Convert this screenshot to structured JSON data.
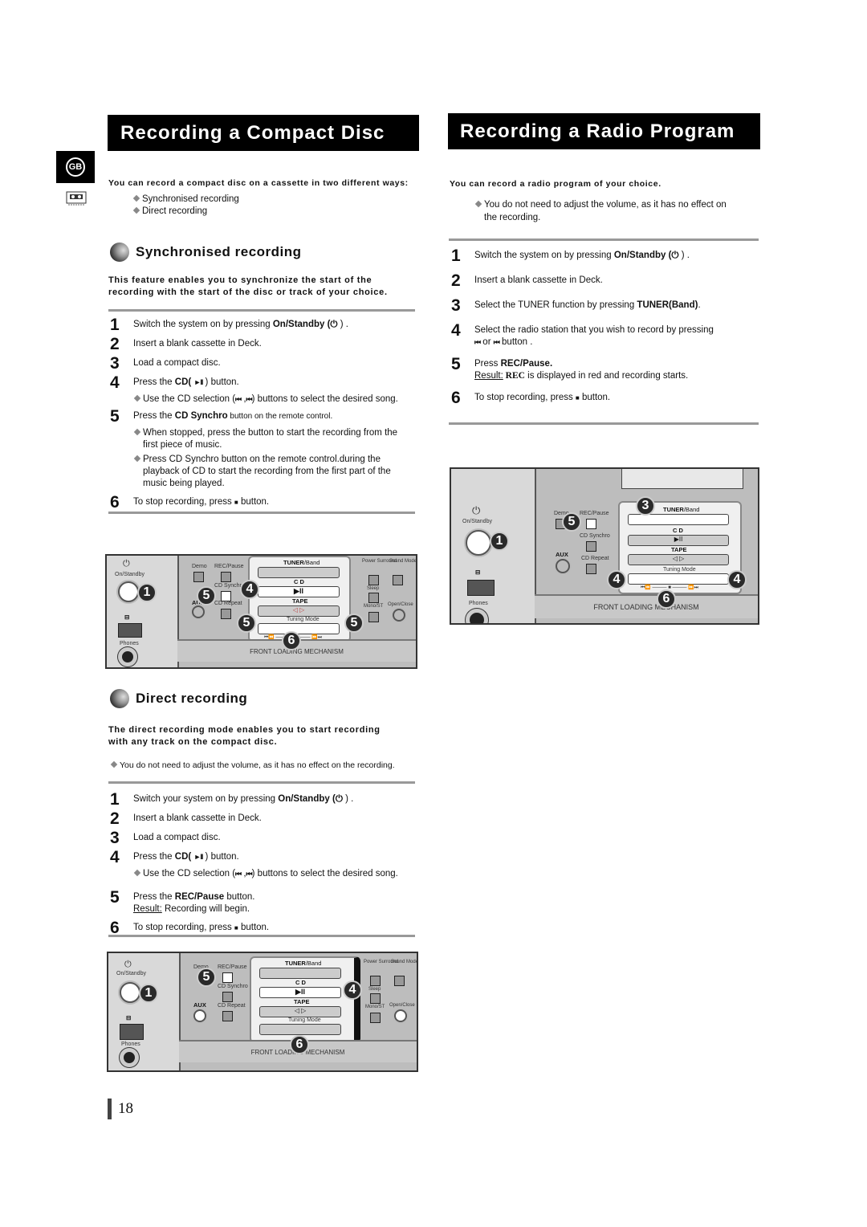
{
  "left": {
    "title": "Recording a Compact Disc",
    "lang_badge": "GB",
    "intro": "You can record a compact disc on a cassette in two different ways:",
    "ways": [
      "Synchronised recording",
      "Direct recording"
    ],
    "sync": {
      "heading": "Synchronised recording",
      "desc_line1": "This feature enables you to synchronize the start of the",
      "desc_line2": "recording with the start of the disc or track of your choice.",
      "steps": [
        {
          "num": "1",
          "pre": "Switch the system on by pressing ",
          "bold": "On/Standby (",
          "post": " ) ."
        },
        {
          "num": "2",
          "text": "Insert a blank cassette in Deck."
        },
        {
          "num": "3",
          "text": "Load a compact disc."
        },
        {
          "num": "4",
          "pre": "Press the ",
          "bold": "CD",
          "post": " ) button.",
          "sub": "Use the CD selection (",
          "sub_post": ") buttons to select the desired song."
        },
        {
          "num": "5",
          "pre": "Press the ",
          "bold": "CD Synchro",
          "post": "  button on the remote control.",
          "subs": [
            "When stopped, press the button to start the recording from the first piece of music.",
            "Press CD Synchro button on the remote control.during the playback of CD to start the recording from the first part of the music being played."
          ]
        },
        {
          "num": "6",
          "pre": "To stop recording, press ",
          "post": " button."
        }
      ]
    },
    "direct": {
      "heading": "Direct recording",
      "desc_line1": "The direct recording mode enables you to start recording",
      "desc_line2": "with any track on the compact disc.",
      "note": "You do not need to adjust the volume, as it has no effect on the recording.",
      "steps": [
        {
          "num": "1",
          "pre": "Switch your system on by pressing ",
          "bold": "On/Standby (",
          "post": " ) ."
        },
        {
          "num": "2",
          "text": "Insert a blank cassette in Deck."
        },
        {
          "num": "3",
          "text": "Load a compact disc."
        },
        {
          "num": "4",
          "pre": "Press the ",
          "bold": "CD",
          "post": " ) button.",
          "sub": "Use the CD selection (",
          "sub_post": ") buttons to select the desired song."
        },
        {
          "num": "5",
          "pre": "Press the ",
          "bold": "REC/Pause",
          "post": " button.",
          "result_label": "Result:",
          "result": "  Recording will begin."
        },
        {
          "num": "6",
          "pre": "To stop recording, press ",
          "post": " button."
        }
      ]
    }
  },
  "right": {
    "title": "Recording a Radio Program",
    "intro": "You can record a radio program of your choice.",
    "note_line1": "You do not need to adjust the volume, as it has no effect on",
    "note_line2": "the recording.",
    "steps": [
      {
        "num": "1",
        "pre": "Switch the system on by pressing ",
        "bold": "On/Standby (",
        "post": " ) ."
      },
      {
        "num": "2",
        "text": "Insert a blank cassette in Deck."
      },
      {
        "num": "3",
        "pre": "Select the TUNER function by pressing ",
        "bold": "TUNER(Band)",
        "post": "."
      },
      {
        "num": "4",
        "text": "Select the radio station that you wish to record by pressing",
        "line2_mid": " or ",
        "line2_post": " button ."
      },
      {
        "num": "5",
        "pre": "Press ",
        "bold": "REC/Pause.",
        "result_label": "Result:",
        "result_rec": " REC",
        "result": " is displayed in red and recording starts."
      },
      {
        "num": "6",
        "pre": "To stop recording, press ",
        "post": " button."
      }
    ]
  },
  "panel": {
    "on_standby": "On/Standby",
    "phones": "Phones",
    "demo": "Demo",
    "rec_pause": "REC/Pause",
    "cd_synchro": "CD Synchro",
    "cd_repeat": "CD Repeat",
    "aux": "AUX",
    "tuner_band_bold": "TUNER",
    "tuner_band": "/Band",
    "cd": "C D",
    "tape": "TAPE",
    "tuning_mode": "Tuning Mode",
    "power_surround": "Power Surround",
    "sound_mode": "Sound Mode",
    "sleep": "Sleep",
    "mono_st": "Mono/ST",
    "open_close": "Open/Close",
    "mechanism": "FRONT LOADING MECHANISM",
    "play_pause": "▶II",
    "tape_dir": "◁ ▷",
    "transport": "⏮⏪ ——— ■ ——— ⏩⏭"
  },
  "callouts": {
    "sync": [
      "1",
      "5",
      "4",
      "5",
      "5",
      "6"
    ],
    "direct": [
      "1",
      "5",
      "4",
      "6"
    ],
    "radio": [
      "3",
      "5",
      "1",
      "4",
      "4",
      "6"
    ]
  },
  "glyphs": {
    "power": "⏻",
    "play_pause": "►II",
    "skip_back": "⏮",
    "stop": "■"
  },
  "page_number": "18"
}
